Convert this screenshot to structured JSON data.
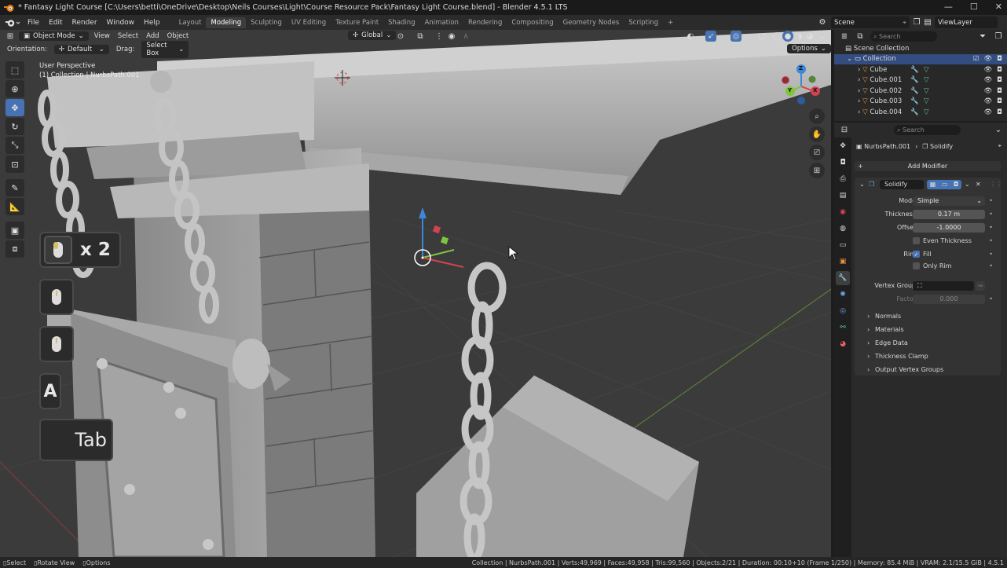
{
  "window": {
    "title": "* Fantasy Light Course [C:\\Users\\betti\\OneDrive\\Desktop\\Neils Courses\\Light\\Course Resource Pack\\Fantasy Light Course.blend] - Blender 4.5.1 LTS"
  },
  "menu": {
    "items": [
      "File",
      "Edit",
      "Render",
      "Window",
      "Help"
    ]
  },
  "workspaces": {
    "tabs": [
      "Layout",
      "Modeling",
      "Sculpting",
      "UV Editing",
      "Texture Paint",
      "Shading",
      "Animation",
      "Rendering",
      "Compositing",
      "Geometry Nodes",
      "Scripting"
    ],
    "active": "Modeling",
    "add": "+"
  },
  "scene": {
    "name": "Scene",
    "view_layer": "ViewLayer"
  },
  "viewport_header": {
    "mode": "Object Mode",
    "menus": [
      "View",
      "Select",
      "Add",
      "Object"
    ],
    "transform": "Global",
    "orientation_label": "Orientation:",
    "orientation_value": "Default",
    "drag_label": "Drag:",
    "drag_value": "Select Box",
    "options": "Options"
  },
  "viewport": {
    "perspective": "User Perspective",
    "collection_info": "(1) Collection | NurbsPath.001"
  },
  "key_overlay": {
    "mouse_count": "x 2",
    "key_a": "A",
    "key_tab": "Tab"
  },
  "gizmo": {
    "x": "X",
    "y": "Y",
    "z": "Z"
  },
  "outliner": {
    "search_placeholder": "Search",
    "root": "Scene Collection",
    "collection": "Collection",
    "items": [
      "Cube",
      "Cube.001",
      "Cube.002",
      "Cube.003",
      "Cube.004"
    ]
  },
  "properties": {
    "search_placeholder": "Search",
    "object": "NurbsPath.001",
    "modifier_crumb": "Solidify",
    "add_modifier": "Add Modifier",
    "modifier_name": "Solidify",
    "mode_label": "Mode",
    "mode_value": "Simple",
    "thickness_label": "Thickness",
    "thickness_value": "0.17 m",
    "offset_label": "Offset",
    "offset_value": "-1.0000",
    "even_thickness": "Even Thickness",
    "rim_label": "Rim",
    "fill": "Fill",
    "only_rim": "Only Rim",
    "vertex_group_label": "Vertex Group",
    "factor_label": "Factor",
    "factor_value": "0.000",
    "subpanels": [
      "Normals",
      "Materials",
      "Edge Data",
      "Thickness Clamp",
      "Output Vertex Groups"
    ]
  },
  "status": {
    "select": "Select",
    "rotate": "Rotate View",
    "options": "Options",
    "stats": "Collection | NurbsPath.001 | Verts:49,969 | Faces:49,958 | Tris:99,560 | Objects:2/21 | Duration: 00:10+10 (Frame 1/250) | Memory: 85.4 MiB | VRAM: 2.1/15.5 GiB | 4.5.1"
  },
  "colors": {
    "accent": "#4772b3",
    "viewport_bg": "#3b3b3b",
    "panel_bg": "#2a2a2a",
    "axis_x": "#d2434f",
    "axis_y": "#7ec43c",
    "axis_z": "#3c87d8"
  }
}
